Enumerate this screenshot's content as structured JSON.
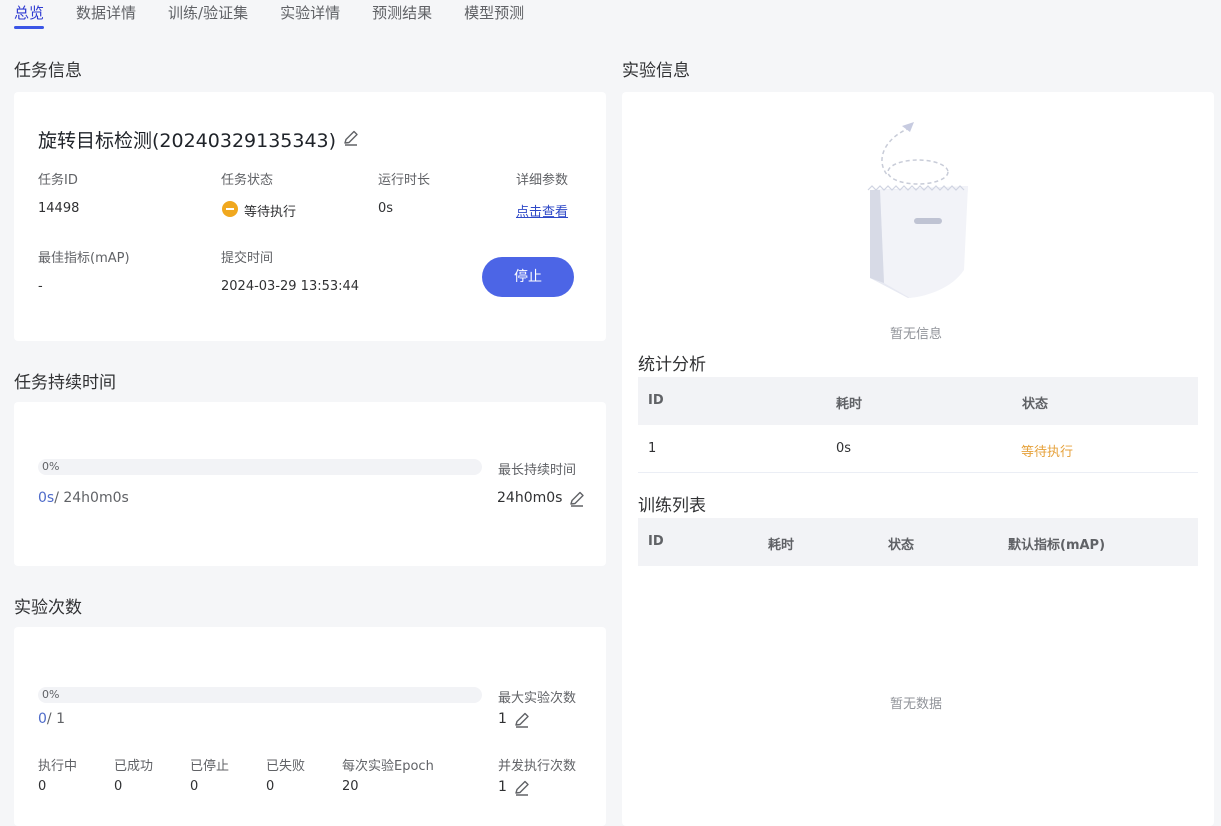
{
  "tabs": [
    {
      "label": "总览",
      "active": true
    },
    {
      "label": "数据详情"
    },
    {
      "label": "训练/验证集"
    },
    {
      "label": "实验详情"
    },
    {
      "label": "预测结果"
    },
    {
      "label": "模型预测"
    }
  ],
  "task_info": {
    "section_title": "任务信息",
    "name": "旋转目标检测(20240329135343)",
    "task_id_label": "任务ID",
    "task_id": "14498",
    "status_label": "任务状态",
    "status": "等待执行",
    "runtime_label": "运行时长",
    "runtime": "0s",
    "params_label": "详细参数",
    "params_link": "点击查看",
    "best_metric_label": "最佳指标(mAP)",
    "best_metric": "-",
    "submit_time_label": "提交时间",
    "submit_time": "2024-03-29 13:53:44",
    "stop_button": "停止",
    "status_color": "#f0a81f",
    "button_color": "#4c65e6"
  },
  "duration": {
    "section_title": "任务持续时间",
    "progress_percent": 0,
    "progress_label": "0%",
    "current": "0s",
    "total": "/ 24h0m0s",
    "max_label": "最长持续时间",
    "max_value": "24h0m0s"
  },
  "experiments": {
    "section_title": "实验次数",
    "progress_percent": 0,
    "progress_label": "0%",
    "current": "0",
    "total": "/ 1",
    "max_label": "最大实验次数",
    "max_value": "1",
    "stats": [
      {
        "label": "执行中",
        "value": "0"
      },
      {
        "label": "已成功",
        "value": "0"
      },
      {
        "label": "已停止",
        "value": "0"
      },
      {
        "label": "已失败",
        "value": "0"
      },
      {
        "label": "每次实验Epoch",
        "value": "20"
      }
    ],
    "concurrency_label": "并发执行次数",
    "concurrency_value": "1"
  },
  "experiment_info": {
    "section_title": "实验信息",
    "empty_text": "暂无信息",
    "illustration_icon": "empty-bag-icon"
  },
  "stats_analysis": {
    "title": "统计分析",
    "columns": [
      "ID",
      "耗时",
      "状态"
    ],
    "rows": [
      {
        "id": "1",
        "elapsed": "0s",
        "status": "等待执行"
      }
    ]
  },
  "training_list": {
    "title": "训练列表",
    "columns": [
      "ID",
      "耗时",
      "状态",
      "默认指标(mAP)"
    ],
    "empty_text": "暂无数据"
  }
}
